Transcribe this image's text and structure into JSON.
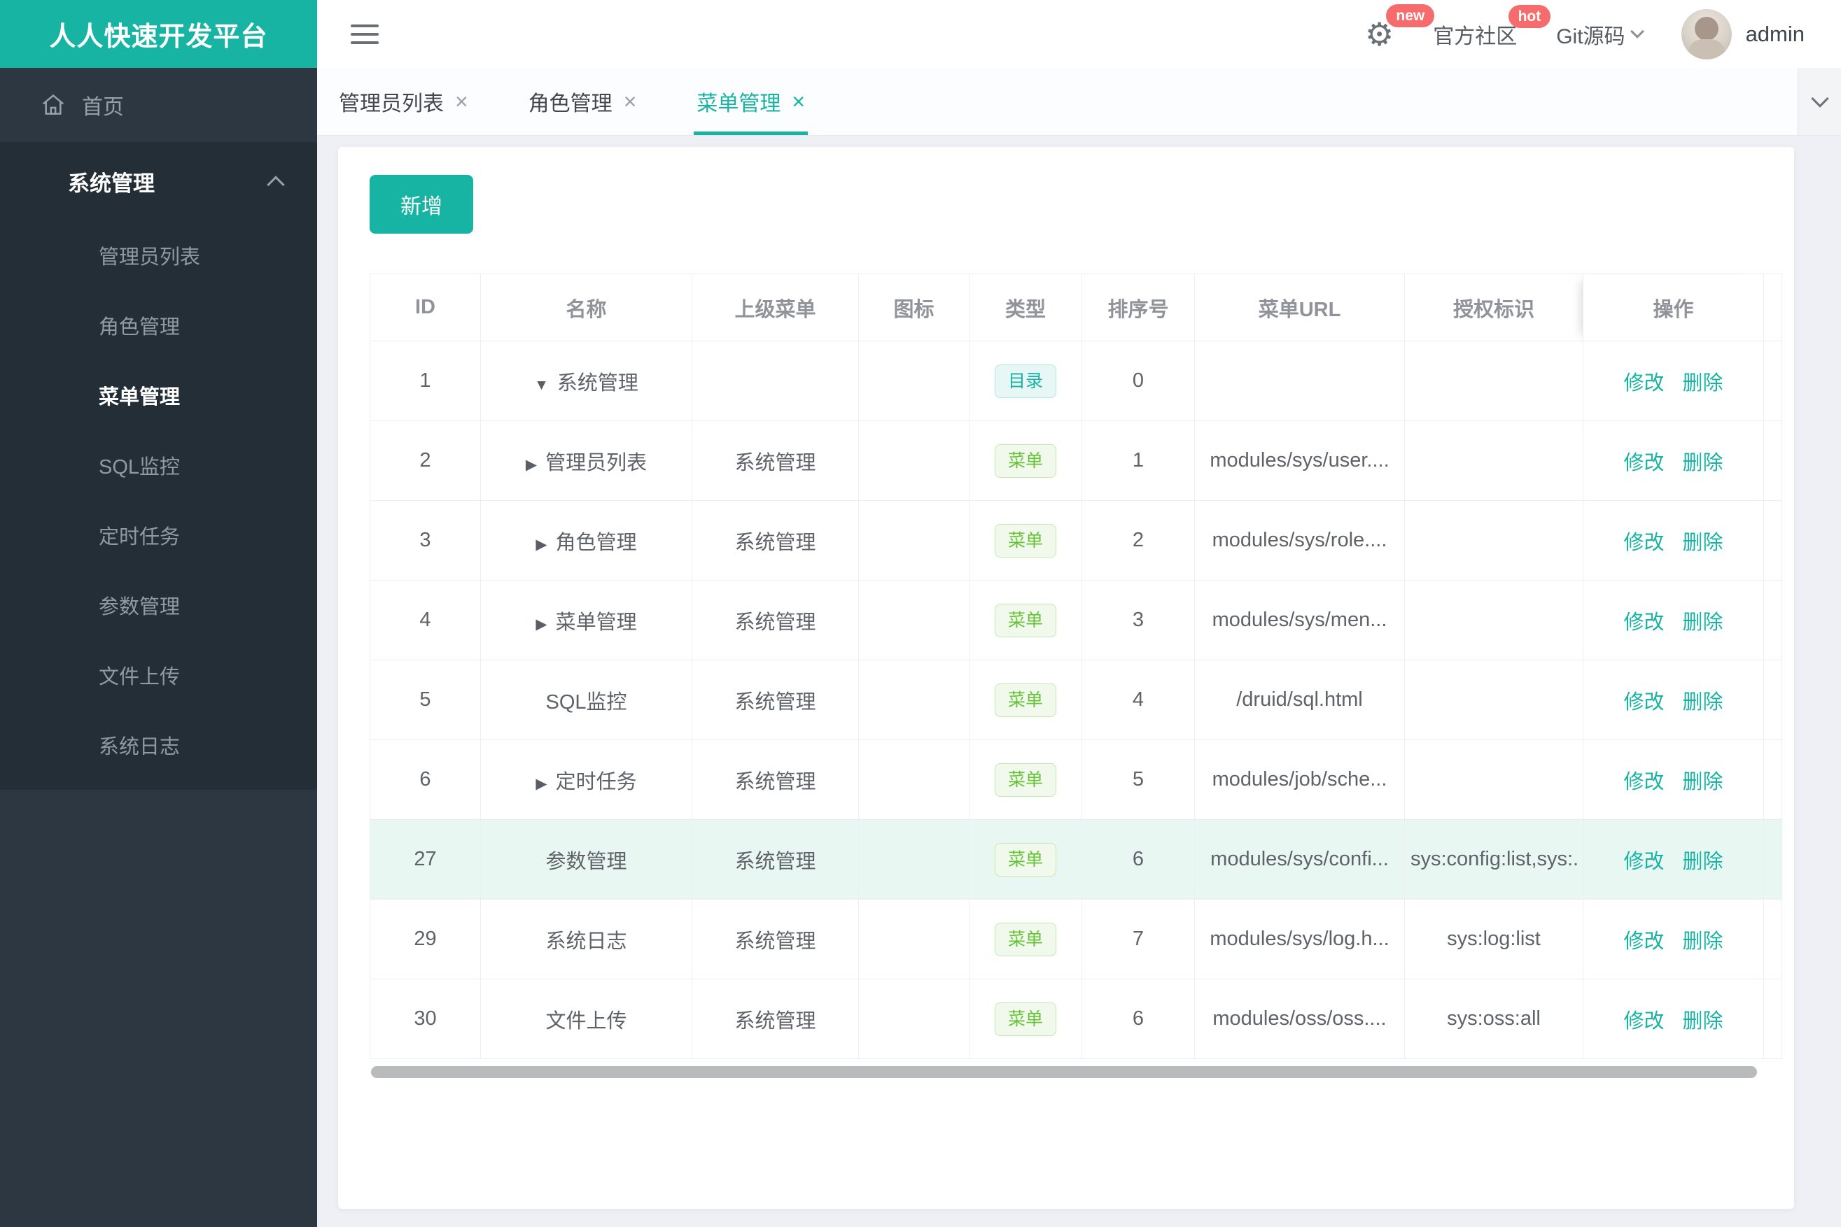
{
  "brand": {
    "title": "人人快速开发平台"
  },
  "topbar": {
    "gear_badge": "new",
    "community_label": "官方社区",
    "community_badge": "hot",
    "git_label": "Git源码",
    "username": "admin"
  },
  "sidebar": {
    "home_label": "首页",
    "group": {
      "label": "系统管理",
      "active_item": "菜单管理",
      "items": [
        "管理员列表",
        "角色管理",
        "菜单管理",
        "SQL监控",
        "定时任务",
        "参数管理",
        "文件上传",
        "系统日志"
      ]
    }
  },
  "tabs": [
    {
      "label": "管理员列表",
      "active": false
    },
    {
      "label": "角色管理",
      "active": false
    },
    {
      "label": "菜单管理",
      "active": true
    }
  ],
  "toolbar": {
    "add_label": "新增"
  },
  "table": {
    "columns": [
      "ID",
      "名称",
      "上级菜单",
      "图标",
      "类型",
      "排序号",
      "菜单URL",
      "授权标识",
      "操作"
    ],
    "action_labels": {
      "edit": "修改",
      "delete": "删除"
    },
    "type_badges": {
      "dir": "目录",
      "menu": "菜单"
    },
    "rows": [
      {
        "id": "1",
        "arrow": "down",
        "name": "系统管理",
        "parent": "",
        "icon": "",
        "type": "目录",
        "type_variant": "dir",
        "order": "0",
        "url": "",
        "auth": "",
        "highlight": false
      },
      {
        "id": "2",
        "arrow": "right",
        "name": "管理员列表",
        "parent": "系统管理",
        "icon": "",
        "type": "菜单",
        "type_variant": "menu",
        "order": "1",
        "url": "modules/sys/user....",
        "auth": "",
        "highlight": false
      },
      {
        "id": "3",
        "arrow": "right",
        "name": "角色管理",
        "parent": "系统管理",
        "icon": "",
        "type": "菜单",
        "type_variant": "menu",
        "order": "2",
        "url": "modules/sys/role....",
        "auth": "",
        "highlight": false
      },
      {
        "id": "4",
        "arrow": "right",
        "name": "菜单管理",
        "parent": "系统管理",
        "icon": "",
        "type": "菜单",
        "type_variant": "menu",
        "order": "3",
        "url": "modules/sys/men...",
        "auth": "",
        "highlight": false
      },
      {
        "id": "5",
        "arrow": "none",
        "name": "SQL监控",
        "parent": "系统管理",
        "icon": "",
        "type": "菜单",
        "type_variant": "menu",
        "order": "4",
        "url": "/druid/sql.html",
        "auth": "",
        "highlight": false
      },
      {
        "id": "6",
        "arrow": "right",
        "name": "定时任务",
        "parent": "系统管理",
        "icon": "",
        "type": "菜单",
        "type_variant": "menu",
        "order": "5",
        "url": "modules/job/sche...",
        "auth": "",
        "highlight": false
      },
      {
        "id": "27",
        "arrow": "none",
        "name": "参数管理",
        "parent": "系统管理",
        "icon": "",
        "type": "菜单",
        "type_variant": "menu",
        "order": "6",
        "url": "modules/sys/confi...",
        "auth": "sys:config:list,sys:.",
        "highlight": true
      },
      {
        "id": "29",
        "arrow": "none",
        "name": "系统日志",
        "parent": "系统管理",
        "icon": "",
        "type": "菜单",
        "type_variant": "menu",
        "order": "7",
        "url": "modules/sys/log.h...",
        "auth": "sys:log:list",
        "highlight": false
      },
      {
        "id": "30",
        "arrow": "none",
        "name": "文件上传",
        "parent": "系统管理",
        "icon": "",
        "type": "菜单",
        "type_variant": "menu",
        "order": "6",
        "url": "modules/oss/oss....",
        "auth": "sys:oss:all",
        "highlight": false
      }
    ]
  },
  "colors": {
    "accent_teal": "#17b3a3",
    "sidebar_bg": "#2c3742",
    "sidebar_group_bg": "#232e36",
    "badge_red": "#f66c6c",
    "tag_dir_text": "#17b3a3",
    "tag_menu_text": "#67c23a",
    "row_highlight_bg": "#e9f7f3"
  }
}
